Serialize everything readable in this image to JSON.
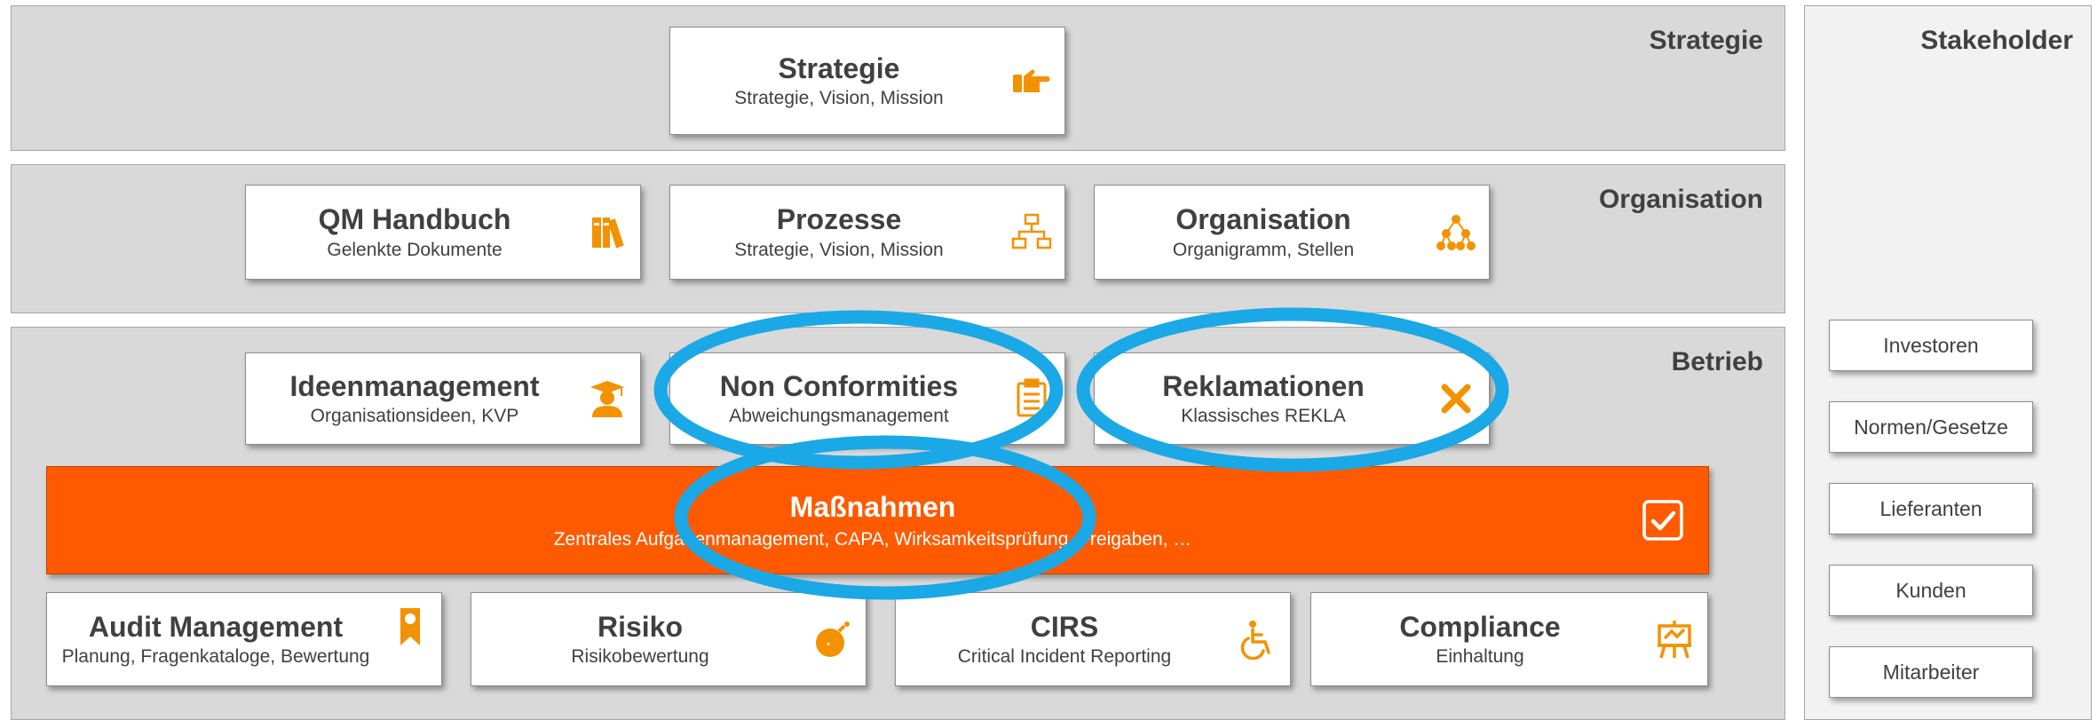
{
  "bands": {
    "strategie": {
      "title": "Strategie"
    },
    "organisation": {
      "title": "Organisation"
    },
    "betrieb": {
      "title": "Betrieb"
    }
  },
  "cards": {
    "strategie": {
      "title": "Strategie",
      "subtitle": "Strategie, Vision, Mission",
      "icon": "hand-pointing-icon"
    },
    "qm_handbuch": {
      "title": "QM Handbuch",
      "subtitle": "Gelenkte Dokumente",
      "icon": "books-icon"
    },
    "prozesse": {
      "title": "Prozesse",
      "subtitle": "Strategie, Vision, Mission",
      "icon": "network-icon"
    },
    "organisation": {
      "title": "Organisation",
      "subtitle": "Organigramm, Stellen",
      "icon": "org-chart-icon"
    },
    "ideenmanagement": {
      "title": "Ideenmanagement",
      "subtitle": "Organisationsideen, KVP",
      "icon": "graduate-icon"
    },
    "non_conformities": {
      "title": "Non Conformities",
      "subtitle": "Abweichungsmanagement",
      "icon": "clipboard-icon"
    },
    "reklamationen": {
      "title": "Reklamationen",
      "subtitle": "Klassisches REKLA",
      "icon": "cross-icon"
    },
    "audit": {
      "title": "Audit Management",
      "subtitle": "Planung, Fragenkataloge, Bewertung",
      "icon": "certificate-icon"
    },
    "risiko": {
      "title": "Risiko",
      "subtitle": "Risikobewertung",
      "icon": "bomb-icon"
    },
    "cirs": {
      "title": "CIRS",
      "subtitle": "Critical Incident Reporting",
      "icon": "wheelchair-icon"
    },
    "compliance": {
      "title": "Compliance",
      "subtitle": "Einhaltung",
      "icon": "easel-icon"
    }
  },
  "massnahmen": {
    "title": "Maßnahmen",
    "subtitle": "Zentrales Aufgabenmanagement, CAPA, Wirksamkeitsprüfung, Freigaben, …",
    "icon": "checkbox-icon"
  },
  "stakeholder": {
    "title": "Stakeholder",
    "items": [
      "Investoren",
      "Normen/Gesetze",
      "Lieferanten",
      "Kunden",
      "Mitarbeiter"
    ]
  },
  "colors": {
    "accent": "#ff5a00",
    "highlight_ring": "#1aa8e6",
    "band_bg": "#d9d9d9",
    "text": "#404040"
  }
}
